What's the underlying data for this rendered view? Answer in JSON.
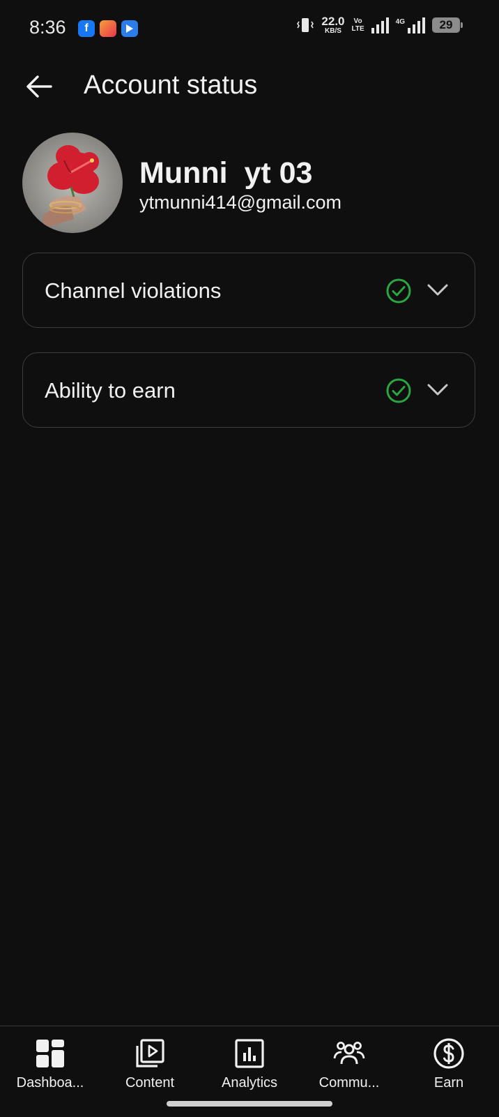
{
  "status_bar": {
    "time": "8:36",
    "apps": [
      {
        "icon": "facebook-icon",
        "glyph": "f",
        "color": "#1877f2"
      },
      {
        "icon": "calendar-app-icon",
        "glyph": "",
        "color": "#f25a3c"
      },
      {
        "icon": "play-store-icon",
        "glyph": "",
        "color": "#2b7de9"
      }
    ],
    "net_speed": "22.0",
    "net_unit": "KB/S",
    "volte_top": "Vo",
    "volte_bottom": "LTE",
    "network": "4G",
    "battery": "29"
  },
  "header": {
    "title": "Account status"
  },
  "profile": {
    "name": "Munni  yt 03",
    "email": "ytmunni414@gmail.com"
  },
  "status_cards": [
    {
      "label": "Channel violations",
      "status_icon": "check-circle-icon",
      "status_color": "#2ba640"
    },
    {
      "label": "Ability to earn",
      "status_icon": "check-circle-icon",
      "status_color": "#2ba640"
    }
  ],
  "bottom_nav": [
    {
      "label": "Dashboa...",
      "icon": "dashboard-icon"
    },
    {
      "label": "Content",
      "icon": "content-icon"
    },
    {
      "label": "Analytics",
      "icon": "analytics-icon"
    },
    {
      "label": "Commu...",
      "icon": "community-icon"
    },
    {
      "label": "Earn",
      "icon": "earn-icon"
    }
  ],
  "colors": {
    "background": "#0f0f0f",
    "text": "#f1f1f1",
    "border": "#3e3e3e",
    "success": "#2ba640"
  }
}
